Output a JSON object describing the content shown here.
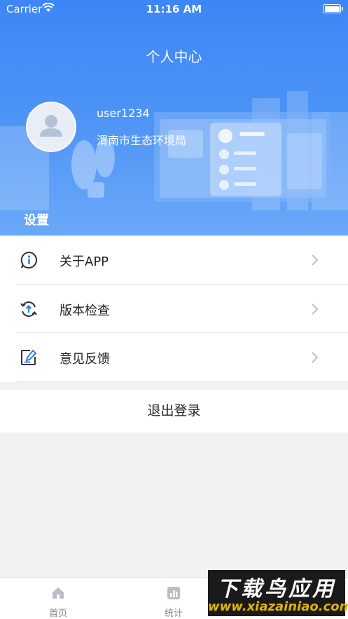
{
  "status_bar": {
    "carrier": "Carrier",
    "time": "11:16 AM"
  },
  "header": {
    "title": "个人中心"
  },
  "profile": {
    "username": "user1234",
    "organization": "渭南市生态环境局"
  },
  "settings": {
    "section_title": "设置",
    "items": [
      {
        "label": "关于APP",
        "icon": "info-icon"
      },
      {
        "label": "版本检查",
        "icon": "update-icon"
      },
      {
        "label": "意见反馈",
        "icon": "feedback-icon"
      }
    ]
  },
  "logout_label": "退出登录",
  "tabbar": {
    "tabs": [
      {
        "label": "首页",
        "icon": "home-icon"
      },
      {
        "label": "统计",
        "icon": "stats-icon"
      }
    ]
  },
  "watermark": {
    "line1": "下载鸟应用",
    "line2": "www.xiazainiao.com"
  },
  "colors": {
    "header_blue": "#3e86f5",
    "icon_blue": "#2f7cf0",
    "icon_dark": "#333333"
  }
}
